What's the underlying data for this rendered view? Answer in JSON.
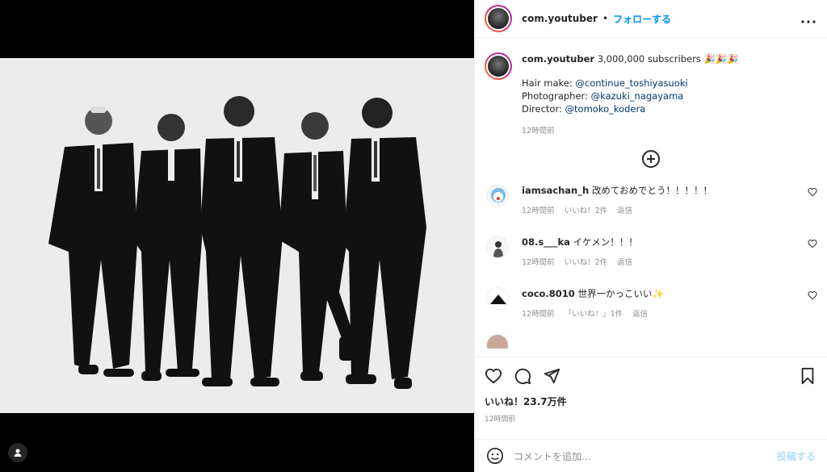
{
  "post": {
    "username": "com.youtuber",
    "separator": "•",
    "follow_label": "フォローする",
    "more_icon": "more-horizontal-icon"
  },
  "caption": {
    "username": "com.youtuber",
    "text": "3,000,000 subscribers",
    "emoji": "🎉🎉🎉",
    "lines": [
      {
        "label": "Hair make: ",
        "handle": "@continue_toshiyasuoki"
      },
      {
        "label": "Photographer: ",
        "handle": "@kazuki_nagayama"
      },
      {
        "label": "Director: ",
        "handle": "@tomoko_kodera"
      }
    ],
    "time": "12時間前"
  },
  "comments": [
    {
      "user": "iamsachan_h",
      "text": "改めておめでとう！！！！！",
      "time": "12時間前",
      "likes": "いいね！2件",
      "reply": "返信"
    },
    {
      "user": "08.s___ka",
      "text": "イケメン！！！",
      "time": "12時間前",
      "likes": "いいね！2件",
      "reply": "返信"
    },
    {
      "user": "coco.8010",
      "text": "世界一かっこいい✨",
      "time": "12時間前",
      "likes": "「いいね！」1件",
      "reply": "返信"
    }
  ],
  "actions": {
    "likes": "いいね！23.7万件",
    "time": "12時間前"
  },
  "add_comment": {
    "placeholder": "コメントを追加...",
    "post_label": "投稿する"
  },
  "colors": {
    "accent": "#0095f6",
    "link": "#00376b",
    "muted": "#8e8e8e",
    "post_disabled": "#b2dffc"
  }
}
